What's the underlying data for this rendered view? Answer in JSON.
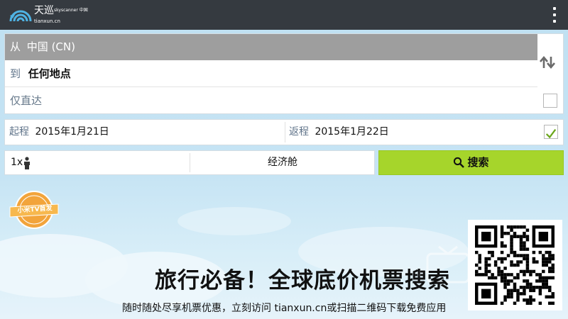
{
  "header": {
    "logo_cn": "天巡",
    "logo_sub": "tianxun.cn",
    "logo_partner": "skyscanner 中国"
  },
  "form": {
    "from_label": "从",
    "from_value": "中国 (CN)",
    "to_label": "到",
    "to_value": "任何地点",
    "direct_label": "仅直达",
    "direct_checked": false,
    "depart_label": "起程",
    "depart_value": "2015年1月21日",
    "return_label": "返程",
    "return_value": "2015年1月22日",
    "return_checked": true,
    "passengers_value": "1x",
    "cabin_value": "经济舱",
    "search_label": "搜索"
  },
  "promo": {
    "badge_text": "小米TV首发",
    "title": "旅行必备！全球底价机票搜索",
    "subtitle": "随时随处尽享机票优惠，立刻访问 tianxun.cn或扫描二维码下载免费应用"
  },
  "colors": {
    "topbar": "#353a40",
    "search_button": "#a6d52b",
    "from_row": "#9e9e9e",
    "checkmark": "#6aa61a"
  },
  "icons": {
    "menu": "overflow-menu-icon",
    "swap": "swap-arrows-icon",
    "person": "person-icon",
    "search": "magnifier-icon"
  }
}
